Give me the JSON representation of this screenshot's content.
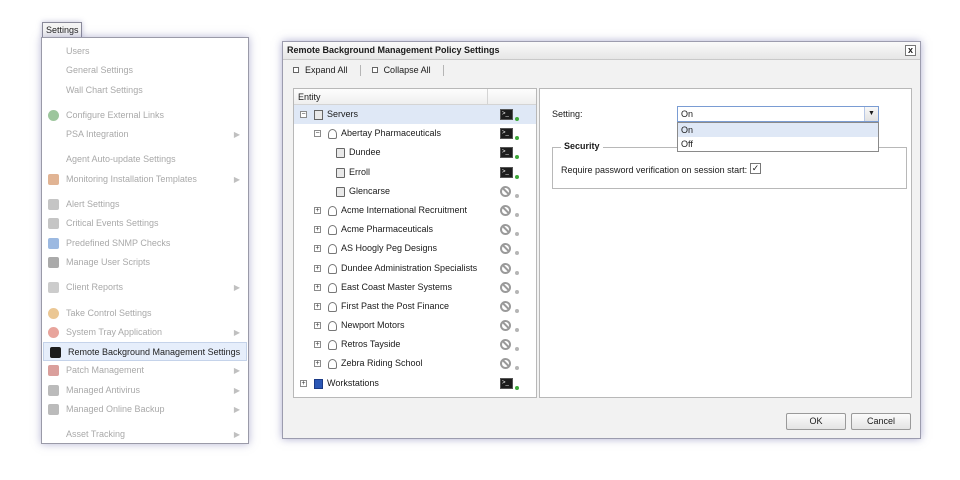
{
  "menu": {
    "tab_label": "Settings",
    "items": [
      {
        "label": "Users",
        "icon": "none",
        "arrow": false,
        "active": false,
        "sep": false
      },
      {
        "label": "General Settings",
        "icon": "none",
        "arrow": false,
        "active": false,
        "sep": false
      },
      {
        "label": "Wall Chart Settings",
        "icon": "none",
        "arrow": false,
        "active": false,
        "sep": false
      },
      {
        "label": "Configure External Links",
        "icon": "globe-icon",
        "arrow": false,
        "active": false,
        "sep": true
      },
      {
        "label": "PSA Integration",
        "icon": "none",
        "arrow": true,
        "active": false,
        "sep": false
      },
      {
        "label": "Agent Auto-update Settings",
        "icon": "none",
        "arrow": false,
        "active": false,
        "sep": true
      },
      {
        "label": "Monitoring Installation Templates",
        "icon": "chart-icon",
        "arrow": true,
        "active": false,
        "sep": false
      },
      {
        "label": "Alert Settings",
        "icon": "document-icon",
        "arrow": false,
        "active": false,
        "sep": true
      },
      {
        "label": "Critical Events Settings",
        "icon": "document-icon",
        "arrow": false,
        "active": false,
        "sep": false
      },
      {
        "label": "Predefined SNMP Checks",
        "icon": "cube-icon",
        "arrow": false,
        "active": false,
        "sep": false
      },
      {
        "label": "Manage User Scripts",
        "icon": "script-icon",
        "arrow": false,
        "active": false,
        "sep": false
      },
      {
        "label": "Client Reports",
        "icon": "person-icon",
        "arrow": true,
        "active": false,
        "sep": true
      },
      {
        "label": "Take Control Settings",
        "icon": "gear-icon",
        "arrow": false,
        "active": false,
        "sep": true
      },
      {
        "label": "System Tray Application",
        "icon": "lifebuoy-icon",
        "arrow": true,
        "active": false,
        "sep": false
      },
      {
        "label": "Remote Background Management Settings",
        "icon": "console-icon",
        "arrow": false,
        "active": true,
        "sep": false
      },
      {
        "label": "Patch Management",
        "icon": "shield-icon",
        "arrow": true,
        "active": false,
        "sep": false
      },
      {
        "label": "Managed Antivirus",
        "icon": "antivirus-icon",
        "arrow": true,
        "active": false,
        "sep": false
      },
      {
        "label": "Managed Online Backup",
        "icon": "backup-icon",
        "arrow": true,
        "active": false,
        "sep": false
      },
      {
        "label": "Asset Tracking",
        "icon": "none",
        "arrow": true,
        "active": false,
        "sep": true
      }
    ]
  },
  "dialog": {
    "title": "Remote Background Management Policy Settings",
    "close_label": "x",
    "toolbar": {
      "expand_all": "Expand All",
      "collapse_all": "Collapse All"
    },
    "tree": {
      "header": "Entity",
      "rows": [
        {
          "label": "Servers",
          "level": 0,
          "expander": "minus",
          "icon": "server-icon",
          "status": "console",
          "selected": true
        },
        {
          "label": "Abertay Pharmaceuticals",
          "level": 1,
          "expander": "minus",
          "icon": "person-icon",
          "status": "console",
          "selected": false
        },
        {
          "label": "Dundee",
          "level": 2,
          "expander": "none",
          "icon": "computer-icon",
          "status": "console",
          "selected": false
        },
        {
          "label": "Erroll",
          "level": 2,
          "expander": "none",
          "icon": "computer-icon",
          "status": "console",
          "selected": false
        },
        {
          "label": "Glencarse",
          "level": 2,
          "expander": "none",
          "icon": "computer-icon",
          "status": "disabled",
          "selected": false
        },
        {
          "label": "Acme International Recruitment",
          "level": 1,
          "expander": "plus",
          "icon": "person-icon",
          "status": "disabled",
          "selected": false
        },
        {
          "label": "Acme Pharmaceuticals",
          "level": 1,
          "expander": "plus",
          "icon": "person-icon",
          "status": "disabled",
          "selected": false
        },
        {
          "label": "AS Hoogly Peg Designs",
          "level": 1,
          "expander": "plus",
          "icon": "person-icon",
          "status": "disabled",
          "selected": false
        },
        {
          "label": "Dundee Administration Specialists",
          "level": 1,
          "expander": "plus",
          "icon": "person-icon",
          "status": "disabled",
          "selected": false
        },
        {
          "label": "East Coast Master Systems",
          "level": 1,
          "expander": "plus",
          "icon": "person-icon",
          "status": "disabled",
          "selected": false
        },
        {
          "label": "First Past the Post Finance",
          "level": 1,
          "expander": "plus",
          "icon": "person-icon",
          "status": "disabled",
          "selected": false
        },
        {
          "label": "Newport Motors",
          "level": 1,
          "expander": "plus",
          "icon": "person-icon",
          "status": "disabled",
          "selected": false
        },
        {
          "label": "Retros Tayside",
          "level": 1,
          "expander": "plus",
          "icon": "person-icon",
          "status": "disabled",
          "selected": false
        },
        {
          "label": "Zebra Riding School",
          "level": 1,
          "expander": "plus",
          "icon": "person-icon",
          "status": "disabled",
          "selected": false
        },
        {
          "label": "Workstations",
          "level": 0,
          "expander": "plus",
          "icon": "workstation-icon",
          "status": "console",
          "selected": false
        }
      ]
    },
    "settings": {
      "setting_label": "Setting:",
      "selected_value": "On",
      "options": [
        "On",
        "Off"
      ],
      "security_legend": "Security",
      "password_label": "Require password verification on session start:",
      "password_checked": true
    },
    "buttons": {
      "ok": "OK",
      "cancel": "Cancel"
    }
  },
  "colors": {
    "status_dot_green": "#3ea83a",
    "selection": "#dfe8f6",
    "menu_disabled_text": "#a9a9a9"
  }
}
